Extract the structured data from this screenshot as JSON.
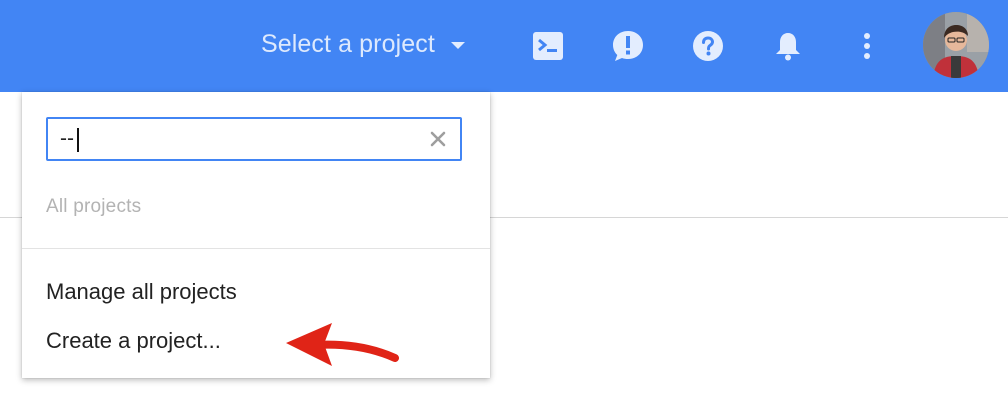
{
  "header": {
    "project_selector_label": "Select a project",
    "icons": {
      "cloud_shell": "terminal-icon",
      "feedback": "feedback-icon",
      "help": "help-icon",
      "notifications": "bell-icon",
      "more": "more-vert-icon"
    },
    "accent_color": "#4285f4"
  },
  "dropdown": {
    "search": {
      "value": "--",
      "clear_icon": "close-icon"
    },
    "section_label": "All projects",
    "menu_items": [
      {
        "label": "Manage all projects"
      },
      {
        "label": "Create a project..."
      }
    ]
  },
  "annotation": {
    "arrow_color": "#e02417"
  }
}
